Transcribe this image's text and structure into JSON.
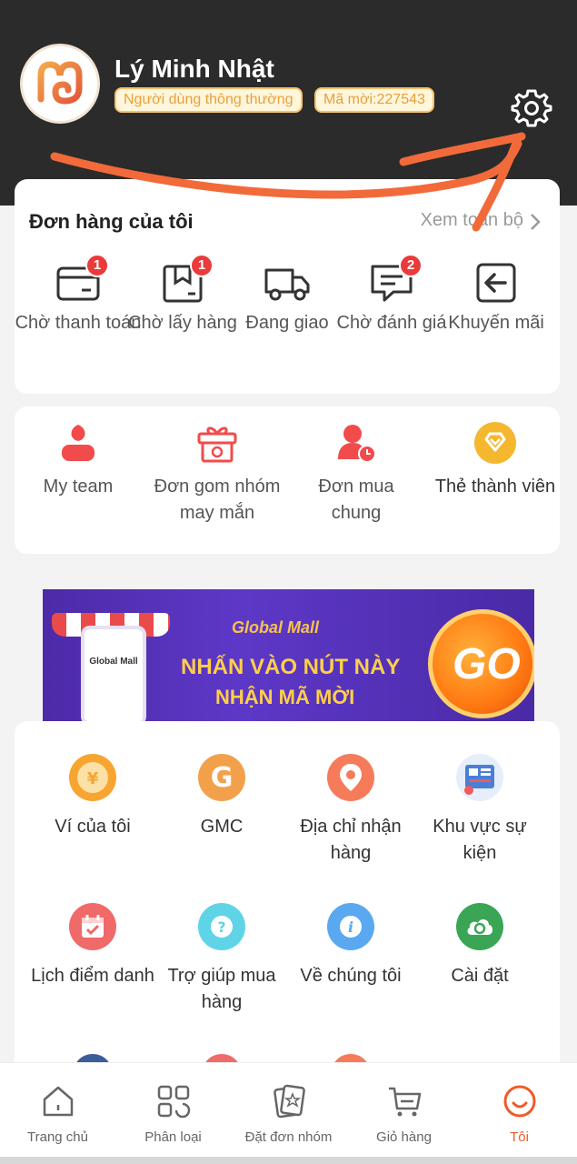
{
  "profile": {
    "name": "Lý Minh Nhật",
    "user_type": "Người dùng thông thường",
    "invite_code": "Mã mời:227543",
    "settings_icon": "gear-icon"
  },
  "orders": {
    "title": "Đơn hàng của tôi",
    "view_all": "Xem toàn bộ",
    "items": [
      {
        "label": "Chờ thanh toán",
        "icon": "wallet-icon",
        "badge": "1"
      },
      {
        "label": "Chờ lấy hàng",
        "icon": "package-icon",
        "badge": "1"
      },
      {
        "label": "Đang giao",
        "icon": "truck-icon",
        "badge": ""
      },
      {
        "label": "Chờ đánh giá",
        "icon": "review-icon",
        "badge": "2"
      },
      {
        "label": "Khuyến mãi",
        "icon": "return-icon",
        "badge": ""
      }
    ]
  },
  "features": [
    {
      "label": "My team",
      "icon": "team-icon"
    },
    {
      "label": "Đơn gom nhóm may mắn",
      "icon": "gift-icon"
    },
    {
      "label": "Đơn mua chung",
      "icon": "group-buy-icon"
    },
    {
      "label": "Thẻ thành viên",
      "icon": "membership-icon"
    }
  ],
  "banner": {
    "brand": "Global Mall",
    "phone_brand": "Global Mall",
    "line1": "NHẤN VÀO NÚT NÀY",
    "line2": "NHẬN MÃ MỜI",
    "cta": "GO"
  },
  "services": [
    {
      "label": "Ví của tôi",
      "icon": "wallet-yen-icon",
      "color": "#f7a531"
    },
    {
      "label": "GMC",
      "icon": "gmc-icon",
      "color": "#f3a04a"
    },
    {
      "label": "Địa chỉ nhận hàng",
      "icon": "location-icon",
      "color": "#f57b5b"
    },
    {
      "label": "Khu vực sự kiện",
      "icon": "event-icon",
      "color": "#4a7fd8"
    },
    {
      "label": "Lịch điểm danh",
      "icon": "calendar-check-icon",
      "color": "#f06a6a"
    },
    {
      "label": "Trợ giúp mua hàng",
      "icon": "help-icon",
      "color": "#5ed4e6"
    },
    {
      "label": "Về chúng tôi",
      "icon": "info-icon",
      "color": "#5aa9f0"
    },
    {
      "label": "Cài đặt",
      "icon": "settings-cloud-icon",
      "color": "#3aa655"
    }
  ],
  "nav": [
    {
      "label": "Trang chủ",
      "icon": "home-icon",
      "active": false
    },
    {
      "label": "Phân loại",
      "icon": "category-icon",
      "active": false
    },
    {
      "label": "Đặt đơn nhóm",
      "icon": "group-order-icon",
      "active": false
    },
    {
      "label": "Giỏ hàng",
      "icon": "cart-icon",
      "active": false
    },
    {
      "label": "Tôi",
      "icon": "profile-icon",
      "active": true
    }
  ],
  "colors": {
    "header_bg": "#2b2b2b",
    "accent": "#f05a28",
    "badge_red": "#ea3a3a",
    "badge_gold": "#f6c36a"
  }
}
